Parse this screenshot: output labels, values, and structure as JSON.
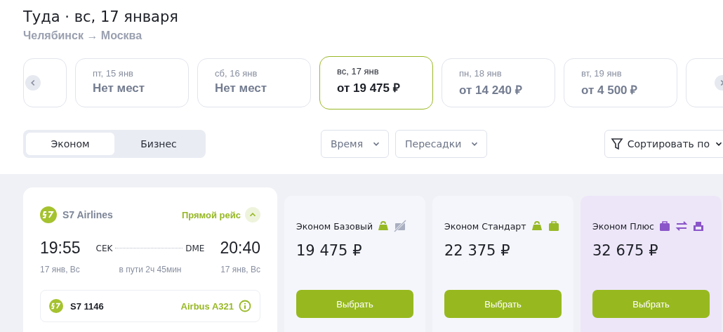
{
  "header": {
    "title": "Туда · вс, 17 января",
    "route": "Челябинск → Москва"
  },
  "dates": [
    {
      "day": "пт, 15 янв",
      "price": "Нет мест",
      "selected": false
    },
    {
      "day": "сб, 16 янв",
      "price": "Нет мест",
      "selected": false
    },
    {
      "day": "вс, 17 янв",
      "price": "от 19 475 ₽",
      "selected": true
    },
    {
      "day": "пн, 18 янв",
      "price": "от 14 240 ₽",
      "selected": false
    },
    {
      "day": "вт, 19 янв",
      "price": "от 4 500 ₽",
      "selected": false
    }
  ],
  "classes": [
    {
      "label": "Эконом",
      "selected": true
    },
    {
      "label": "Бизнес",
      "selected": false
    }
  ],
  "filters": [
    "Время",
    "Пересадки"
  ],
  "sort": "Сортировать по",
  "flight": {
    "airline": "S7 Airlines",
    "type": "Прямой рейс",
    "expanded": true,
    "dep_time": "19:55",
    "dep_code": "CEK",
    "arr_code": "DME",
    "arr_time": "20:40",
    "dep_date": "17 янв, Вс",
    "duration": "в пути 2ч 45мин",
    "arr_date": "17 янв, Вс",
    "number": "S7 1146",
    "aircraft": "Airbus A321"
  },
  "fares": [
    {
      "name": "Эконом Базовый",
      "price": "19 475 ₽",
      "highlighted": false,
      "icons": [
        {
          "kind": "hand-bag"
        },
        {
          "kind": "no-luggage"
        }
      ],
      "button": "Выбрать"
    },
    {
      "name": "Эконом Стандарт",
      "price": "22 375 ₽",
      "highlighted": false,
      "icons": [
        {
          "kind": "hand-bag"
        },
        {
          "kind": "luggage"
        }
      ],
      "button": "Выбрать"
    },
    {
      "name": "Эконом Плюс",
      "price": "32 675 ₽",
      "highlighted": true,
      "icons": [
        {
          "kind": "luggage"
        },
        {
          "kind": "exchange"
        },
        {
          "kind": "seat"
        }
      ],
      "button": "Выбрать"
    }
  ]
}
